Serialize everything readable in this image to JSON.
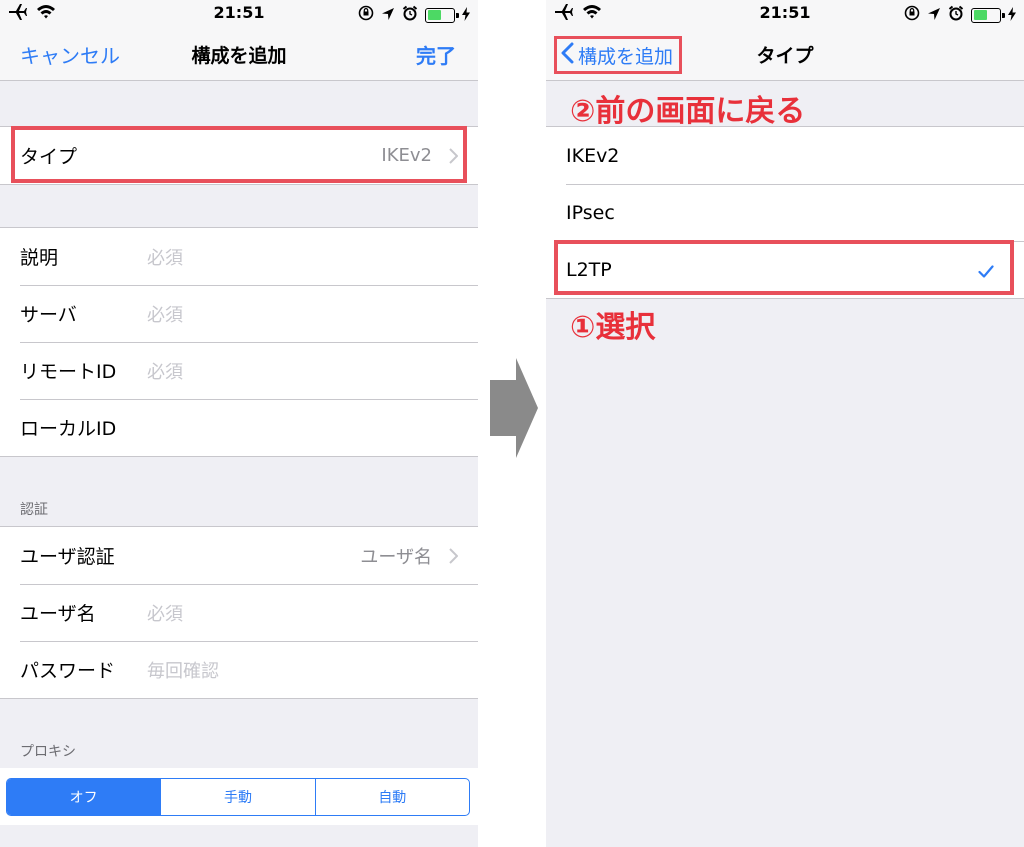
{
  "status_bar": {
    "time": "21:51"
  },
  "left_screen": {
    "nav": {
      "cancel_label": "キャンセル",
      "title": "構成を追加",
      "done_label": "完了"
    },
    "type_row": {
      "label": "タイプ",
      "value": "IKEv2"
    },
    "details": [
      {
        "label": "説明",
        "placeholder": "必須"
      },
      {
        "label": "サーバ",
        "placeholder": "必須"
      },
      {
        "label": "リモートID",
        "placeholder": "必須"
      },
      {
        "label": "ローカルID",
        "placeholder": ""
      }
    ],
    "auth_header": "認証",
    "auth": {
      "user_auth": {
        "label": "ユーザ認証",
        "value": "ユーザ名"
      },
      "username": {
        "label": "ユーザ名",
        "placeholder": "必須"
      },
      "password": {
        "label": "パスワード",
        "placeholder": "毎回確認"
      }
    },
    "proxy_header": "プロキシ",
    "proxy_options": [
      {
        "label": "オフ",
        "selected": true
      },
      {
        "label": "手動",
        "selected": false
      },
      {
        "label": "自動",
        "selected": false
      }
    ]
  },
  "right_screen": {
    "nav": {
      "back_label": "構成を追加",
      "title": "タイプ"
    },
    "types": [
      {
        "label": "IKEv2",
        "checked": false
      },
      {
        "label": "IPsec",
        "checked": false
      },
      {
        "label": "L2TP",
        "checked": true
      }
    ]
  },
  "annotations": {
    "step1": "①選択",
    "step2": "②前の画面に戻る"
  },
  "colors": {
    "accent": "#2e7cf6",
    "highlight": "#e8505b",
    "annotation_text": "#e8303a",
    "arrow": "#8a8a8a"
  }
}
